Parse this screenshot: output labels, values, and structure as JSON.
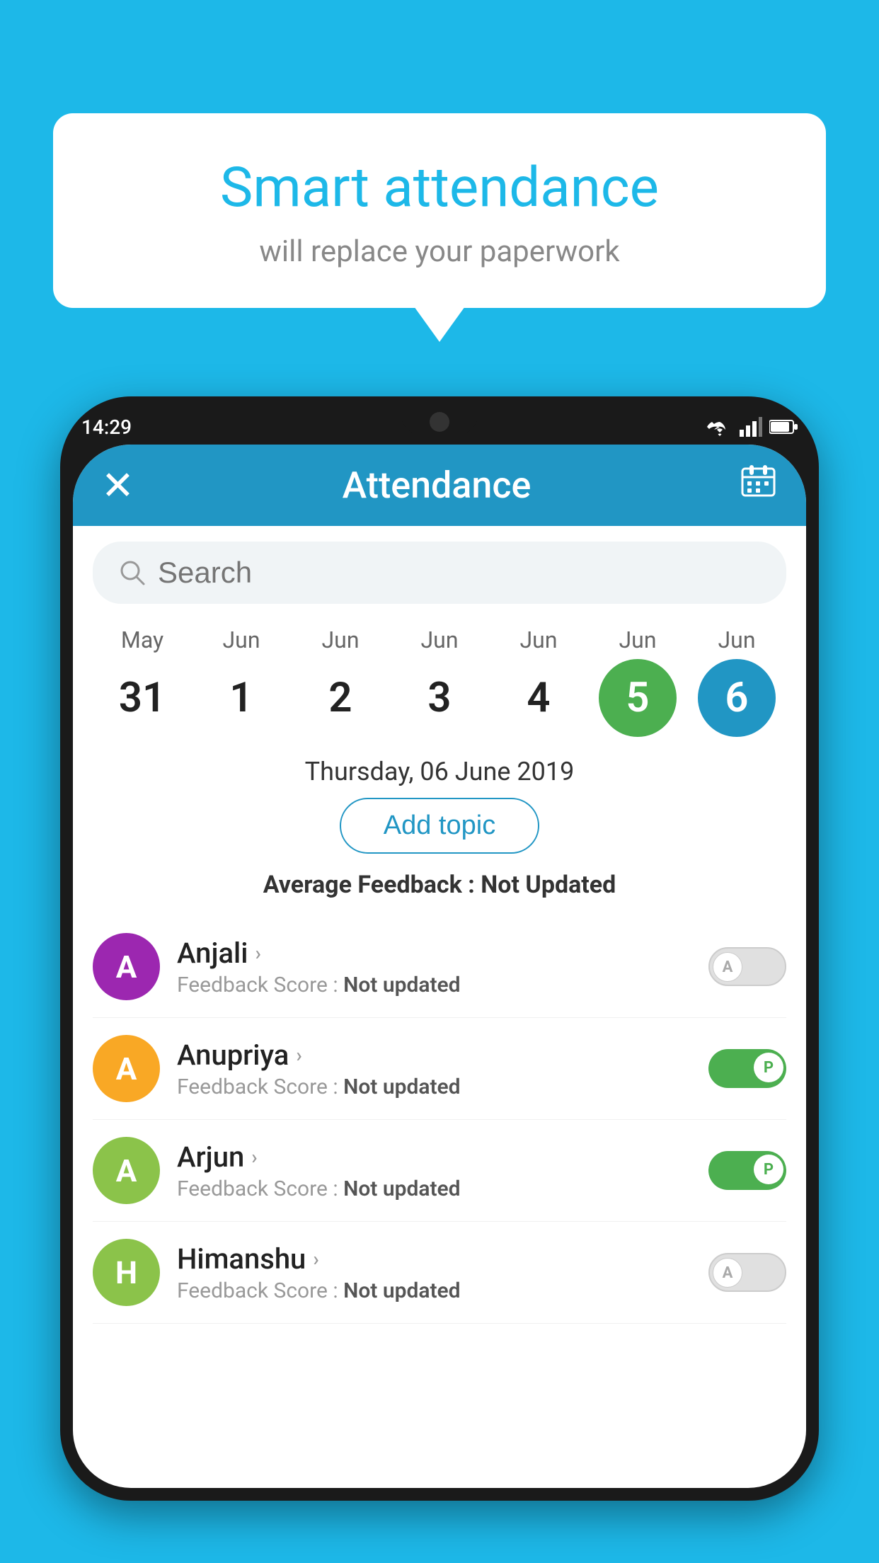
{
  "background_color": "#1db8e8",
  "bubble": {
    "title": "Smart attendance",
    "subtitle": "will replace your paperwork"
  },
  "status_bar": {
    "time": "14:29",
    "icons": [
      "wifi",
      "signal",
      "battery"
    ]
  },
  "header": {
    "title": "Attendance",
    "close_label": "×",
    "calendar_icon": "calendar"
  },
  "search": {
    "placeholder": "Search"
  },
  "calendar": {
    "days": [
      {
        "month": "May",
        "date": "31",
        "state": "normal"
      },
      {
        "month": "Jun",
        "date": "1",
        "state": "normal"
      },
      {
        "month": "Jun",
        "date": "2",
        "state": "normal"
      },
      {
        "month": "Jun",
        "date": "3",
        "state": "normal"
      },
      {
        "month": "Jun",
        "date": "4",
        "state": "normal"
      },
      {
        "month": "Jun",
        "date": "5",
        "state": "today"
      },
      {
        "month": "Jun",
        "date": "6",
        "state": "selected"
      }
    ],
    "selected_date_label": "Thursday, 06 June 2019"
  },
  "add_topic_button": "Add topic",
  "average_feedback": {
    "label": "Average Feedback : ",
    "value": "Not Updated"
  },
  "students": [
    {
      "name": "Anjali",
      "avatar_letter": "A",
      "avatar_color": "#9c27b0",
      "feedback": "Not updated",
      "toggle_state": "off",
      "toggle_label": "A"
    },
    {
      "name": "Anupriya",
      "avatar_letter": "A",
      "avatar_color": "#f9a825",
      "feedback": "Not updated",
      "toggle_state": "on",
      "toggle_label": "P"
    },
    {
      "name": "Arjun",
      "avatar_letter": "A",
      "avatar_color": "#8bc34a",
      "feedback": "Not updated",
      "toggle_state": "on",
      "toggle_label": "P"
    },
    {
      "name": "Himanshu",
      "avatar_letter": "H",
      "avatar_color": "#8bc34a",
      "feedback": "Not updated",
      "toggle_state": "off",
      "toggle_label": "A"
    }
  ]
}
